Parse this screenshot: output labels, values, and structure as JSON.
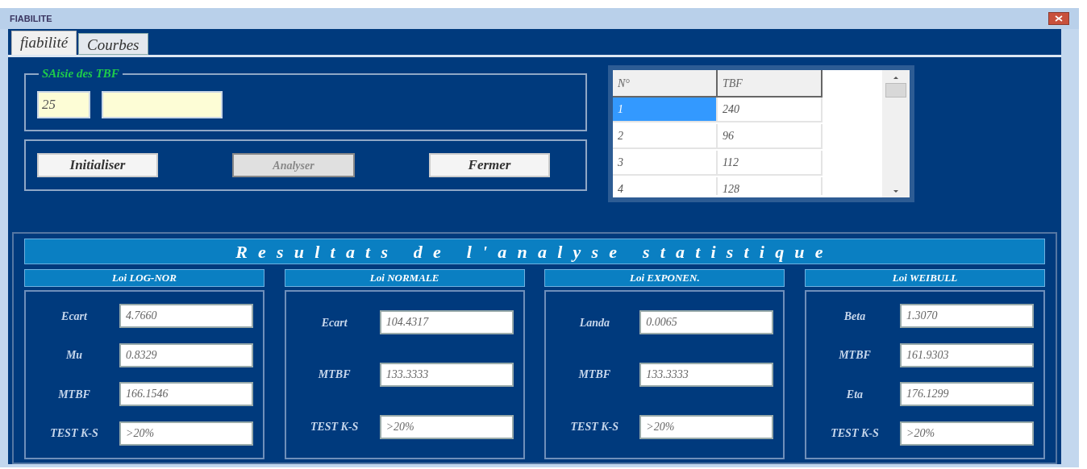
{
  "window": {
    "title": "FIABILITE"
  },
  "tabs": [
    {
      "label": "fiabilité",
      "selected": true
    },
    {
      "label": "Courbes",
      "selected": false
    }
  ],
  "saisie": {
    "title": "SAisie des TBF",
    "fields": [
      {
        "kind": "number",
        "value": "25"
      },
      {
        "kind": "text"
      }
    ]
  },
  "buttons": [
    {
      "label": "Initialiser",
      "disabled": false
    },
    {
      "label": "Analyser",
      "disabled": true
    },
    {
      "label": "Fermer",
      "disabled": false
    }
  ],
  "table": {
    "columns": [
      "N°",
      "TBF"
    ],
    "rows": [
      {
        "cells": [
          "1",
          "240"
        ],
        "selected": true
      },
      {
        "cells": [
          "2",
          "96"
        ],
        "selected": false
      },
      {
        "cells": [
          "3",
          "112"
        ],
        "selected": false
      },
      {
        "cells": [
          "4",
          "128"
        ],
        "selected": false
      }
    ]
  },
  "results": {
    "title": "Resultats de l'analyse statistique",
    "laws": [
      {
        "title": "Loi LOG-NOR",
        "fields": [
          {
            "label": "Ecart",
            "value": "4.7660"
          },
          {
            "label": "Mu",
            "value": "0.8329"
          },
          {
            "label": "MTBF",
            "value": "166.1546"
          },
          {
            "label": "TEST K-S",
            "value": ">20%"
          }
        ]
      },
      {
        "title": "Loi NORMALE",
        "fields": [
          {
            "label": "Ecart",
            "value": "104.4317"
          },
          {
            "label": "MTBF",
            "value": "133.3333"
          },
          {
            "label": "TEST K-S",
            "value": ">20%"
          }
        ]
      },
      {
        "title": "Loi EXPONEN.",
        "fields": [
          {
            "label": "Landa",
            "value": "0.0065"
          },
          {
            "label": "MTBF",
            "value": "133.3333"
          },
          {
            "label": "TEST K-S",
            "value": ">20%"
          }
        ]
      },
      {
        "title": "Loi WEIBULL",
        "fields": [
          {
            "label": "Beta",
            "value": "1.3070"
          },
          {
            "label": "MTBF",
            "value": "161.9303"
          },
          {
            "label": "Eta",
            "value": "176.1299"
          },
          {
            "label": "TEST K-S",
            "value": ">20%"
          }
        ]
      }
    ]
  }
}
